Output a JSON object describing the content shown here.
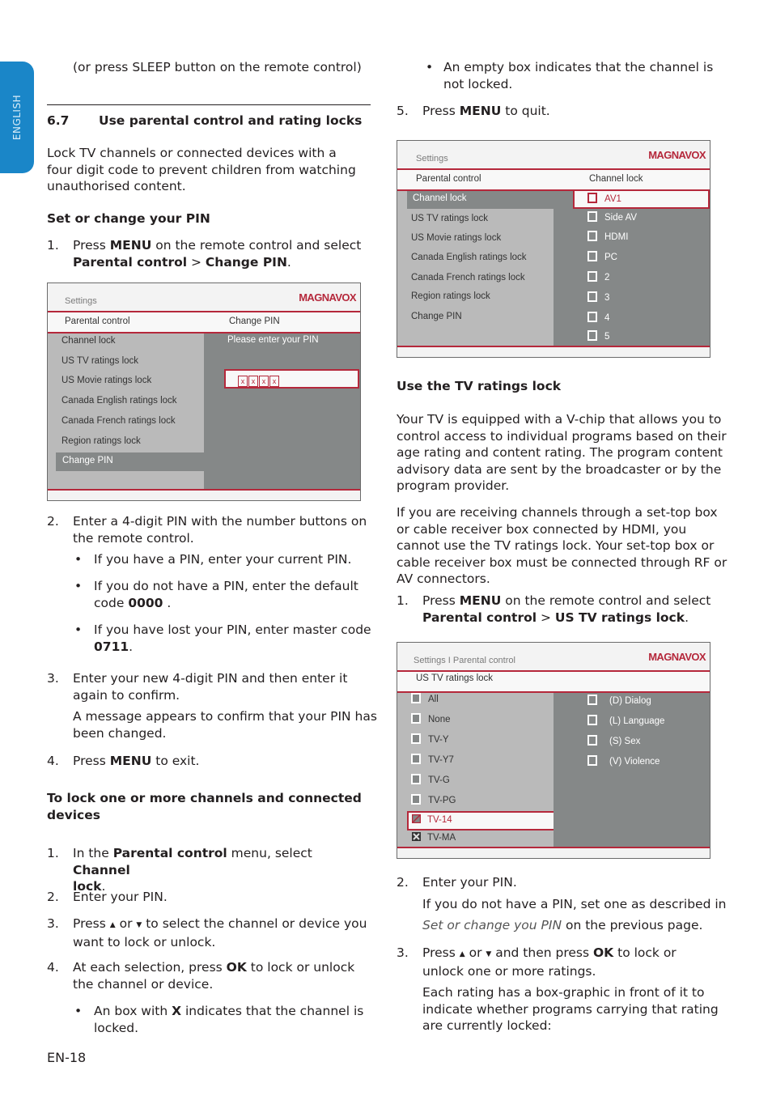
{
  "side_tab": {
    "label": "ENGLISH"
  },
  "page_number": "EN-18",
  "colors": {
    "accent_blue": "#1a86c8",
    "brand_red": "#b5283b",
    "menu_dark_gray": "#858888",
    "menu_light_gray": "#bababa"
  },
  "left_col": {
    "intro_line": "(or press SLEEP button on the remote control)",
    "section_num": "6.7",
    "section_title": "Use parental control and rating locks",
    "intro_para": [
      "Lock TV channels or connected devices with a",
      "four digit code to prevent children from watching",
      "unauthorised content."
    ],
    "set_pin_heading": "Set or change your PIN",
    "step1": {
      "num": "1.",
      "pre": "Press ",
      "menu": "MENU",
      "mid": " on the remote control and select",
      "path_a": "Parental control",
      "sep": " > ",
      "path_b": "Change PIN",
      "end": "."
    },
    "step2": {
      "num": "2.",
      "lines": [
        "Enter a 4-digit PIN with the number buttons on",
        "the remote control."
      ]
    },
    "bullets": [
      {
        "text": "If you have a PIN, enter your current PIN."
      },
      {
        "text": "If you do not have a PIN, enter the default",
        "line2_pre": "code ",
        "code": "0000",
        "line2_post": " ."
      },
      {
        "text": "If you have lost your PIN, enter master code",
        "code": "0711",
        "line2_post": "."
      }
    ],
    "step3": {
      "num": "3.",
      "lines": [
        "Enter your new 4-digit PIN and then enter it",
        "again to confirm."
      ],
      "note": [
        "A message appears to confirm that your PIN has",
        "been changed."
      ]
    },
    "step4": {
      "num": "4.",
      "pre": "Press ",
      "menu": "MENU",
      "post": " to exit."
    },
    "lock_heading": [
      "To lock one or more channels and connected",
      "devices"
    ],
    "lock_step1": {
      "num": "1.",
      "pre": "In the ",
      "b1": "Parental control",
      "mid": " menu, select ",
      "b2": "Channel",
      "b3": "lock",
      "end": "."
    },
    "lock_step2": {
      "num": "2.",
      "text": "Enter your PIN."
    },
    "lock_step3": {
      "num": "3.",
      "pre": "Press ",
      "up": "▲",
      "or": " or ",
      "down": "▼",
      "post": " to select the channel or device you",
      "line2": "want to lock or unlock."
    },
    "lock_step4": {
      "num": "4.",
      "pre": "At each selection, press ",
      "ok": "OK",
      "post": " to lock or unlock",
      "line2": "the channel or device."
    },
    "lock_bullet": {
      "pre": "An box with ",
      "x": "X",
      "post": " indicates that the channel is",
      "line2": "locked."
    }
  },
  "right_col": {
    "bullet_empty": [
      "An empty box indicates that the channel is",
      "not locked."
    ],
    "step5": {
      "num": "5.",
      "pre": "Press ",
      "menu": "MENU",
      "post": " to quit."
    },
    "tv_heading": "Use the TV ratings lock",
    "para1": [
      "Your TV is equipped with a V-chip that allows you to",
      "control access to individual programs based on their",
      "age rating and content rating.  The program content",
      "advisory data are sent by the broadcaster or by the",
      "program provider."
    ],
    "para2": [
      "If you are receiving channels through a set-top box",
      "or cable receiver box connected by HDMI, you",
      "cannot use the TV ratings lock. Your set-top box or",
      "cable receiver box must be connected through RF or",
      "AV connectors."
    ],
    "step1": {
      "num": "1.",
      "pre": "Press ",
      "menu": "MENU",
      "mid": " on the remote control and select",
      "path_a": "Parental control",
      "sep": " > ",
      "path_b": "US TV ratings lock",
      "end": "."
    },
    "step2": {
      "num": "2.",
      "text": "Enter your PIN.",
      "note": "If you do not have a PIN, set one as described in",
      "link": "Set or change you PIN",
      "link_post": " on the previous page."
    },
    "step3": {
      "num": "3.",
      "pre": "Press ",
      "up": "▲",
      "or": " or ",
      "down": "▼",
      "mid": " and then press ",
      "ok": "OK",
      "post": " to lock or",
      "line2": "unlock one or more ratings.",
      "note": [
        "Each rating has a box-graphic in front of it to",
        "indicate whether programs carrying that rating",
        "are currently locked:"
      ]
    }
  },
  "menu_change_pin": {
    "crumb": "Settings",
    "logo": "MAGNAVOX",
    "sub_left": "Parental control",
    "sub_right": "Change PIN",
    "items": [
      "Channel lock",
      "US TV ratings lock",
      "US Movie ratings lock",
      "Canada English ratings lock",
      "Canada French ratings lock",
      "Region ratings lock",
      "Change PIN"
    ],
    "selected_index": 6,
    "prompt": "Please enter your PIN",
    "pin_mask": [
      "x",
      "x",
      "x",
      "x"
    ]
  },
  "menu_channel_lock": {
    "crumb": "Settings",
    "logo": "MAGNAVOX",
    "sub_left": "Parental control",
    "sub_right": "Channel lock",
    "items": [
      "Channel lock",
      "US TV ratings lock",
      "US Movie ratings lock",
      "Canada English ratings lock",
      "Canada French ratings lock",
      "Region ratings lock",
      "Change PIN"
    ],
    "selected_index": 0,
    "channels": [
      {
        "label": "AV1",
        "locked": false,
        "highlighted": true
      },
      {
        "label": "Side AV",
        "locked": false
      },
      {
        "label": "HDMI",
        "locked": false
      },
      {
        "label": "PC",
        "locked": false
      },
      {
        "label": "2",
        "locked": false
      },
      {
        "label": "3",
        "locked": false
      },
      {
        "label": "4",
        "locked": false
      },
      {
        "label": "5",
        "locked": false
      }
    ]
  },
  "menu_tv_ratings": {
    "crumb": "Settings I Parental control",
    "logo": "MAGNAVOX",
    "sub_left": "US TV ratings lock",
    "ratings": [
      {
        "label": "All",
        "state": "unlocked"
      },
      {
        "label": "None",
        "state": "unlocked"
      },
      {
        "label": "TV-Y",
        "state": "unlocked"
      },
      {
        "label": "TV-Y7",
        "state": "unlocked"
      },
      {
        "label": "TV-G",
        "state": "unlocked"
      },
      {
        "label": "TV-PG",
        "state": "unlocked"
      },
      {
        "label": "TV-14",
        "state": "partial",
        "highlighted": true
      },
      {
        "label": "TV-MA",
        "state": "locked"
      }
    ],
    "content": [
      {
        "label": "(D) Dialog",
        "locked": false
      },
      {
        "label": "(L) Language",
        "locked": false
      },
      {
        "label": "(S) Sex",
        "locked": false
      },
      {
        "label": "(V) Violence",
        "locked": false
      }
    ]
  }
}
